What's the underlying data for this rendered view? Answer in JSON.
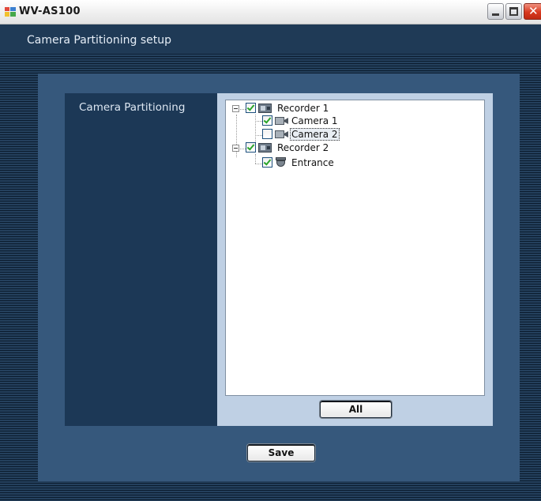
{
  "window": {
    "title": "WV-AS100"
  },
  "header": {
    "title": "Camera Partitioning setup"
  },
  "panel": {
    "label": "Camera Partitioning"
  },
  "tree": {
    "recorders": [
      {
        "label": "Recorder 1",
        "checked": true,
        "expanded": true,
        "icon": "recorder-icon",
        "cameras": [
          {
            "label": "Camera 1",
            "checked": true,
            "icon": "camera-icon",
            "selected": false
          },
          {
            "label": "Camera 2",
            "checked": false,
            "icon": "camera-icon",
            "selected": true
          }
        ]
      },
      {
        "label": "Recorder 2",
        "checked": true,
        "expanded": true,
        "icon": "recorder-icon",
        "cameras": [
          {
            "label": "Entrance",
            "checked": true,
            "icon": "dome-camera-icon",
            "selected": false
          }
        ]
      }
    ]
  },
  "buttons": {
    "all": "All",
    "save": "Save"
  },
  "colors": {
    "header_bg": "#1f3a56",
    "panel_bg": "#36587c",
    "label_column_bg": "#1c3856",
    "tree_frame_bg": "#bfd0e4",
    "check_green": "#2aa52a"
  }
}
